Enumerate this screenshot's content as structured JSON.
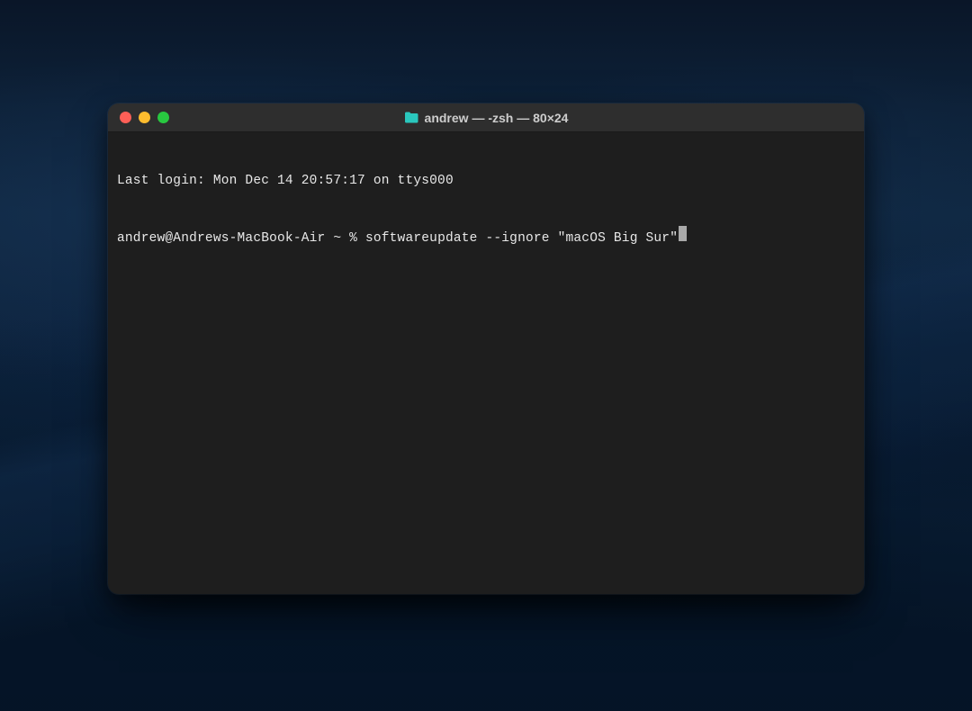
{
  "window": {
    "title": "andrew — -zsh — 80×24",
    "folder_icon_color": "#2ac7bd"
  },
  "terminal": {
    "last_login": "Last login: Mon Dec 14 20:57:17 on ttys000",
    "prompt": "andrew@Andrews-MacBook-Air ~ % ",
    "command": "softwareupdate --ignore \"macOS Big Sur\""
  }
}
